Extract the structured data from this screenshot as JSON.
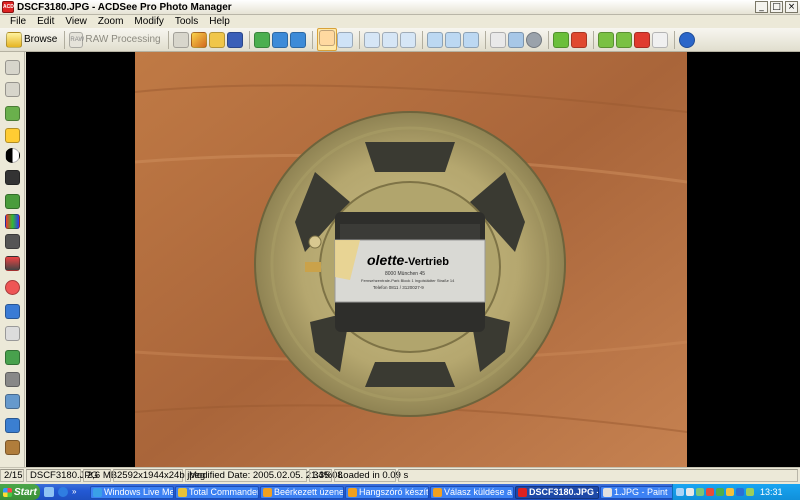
{
  "window": {
    "title": "DSCF3180.JPG - ACDSee Pro Photo Manager",
    "app_icon": "ACD"
  },
  "window_buttons": [
    "_",
    "□",
    "×"
  ],
  "menu": [
    "File",
    "Edit",
    "View",
    "Zoom",
    "Modify",
    "Tools",
    "Help"
  ],
  "toolbar": {
    "browse_label": "Browse",
    "raw_badge": "RAW",
    "raw_label": "RAW Processing"
  },
  "photo": {
    "label_brand": "olette",
    "label_suffix": "-Vertrieb",
    "label_line1": "8000 München 45",
    "label_line2": "Fernsehzentrale-Park  Block  1 Ingolstädter Straße 14",
    "label_line3": "Telefon 0811 / 3120027-9"
  },
  "status": {
    "position": "2/15",
    "filename": "DSCF3180.JPG",
    "filesize": "2,6 MB",
    "dimensions": "2592x1944x24b jpeg",
    "modified": "Modified Date: 2005.02.05. 21:35:08",
    "zoom": "34%",
    "load_time": "Loaded in 0.09 s"
  },
  "taskbar": {
    "start_label": "Start",
    "tasks": [
      {
        "label": "Windows Live Mes...",
        "color": "#3aa0e8"
      },
      {
        "label": "Total Commander ...",
        "color": "#e8c23a"
      },
      {
        "label": "Beérkezett üzenet...",
        "color": "#f0a020"
      },
      {
        "label": "Hangszóró készíté...",
        "color": "#f0a020"
      },
      {
        "label": "Válasz küldése a fó...",
        "color": "#f0a020"
      },
      {
        "label": "DSCF3180.JPG - ...",
        "color": "#d22"
      },
      {
        "label": "1.JPG - Paint",
        "color": "#e0e0e0"
      }
    ],
    "active_task": 5,
    "clock": "13:31"
  }
}
